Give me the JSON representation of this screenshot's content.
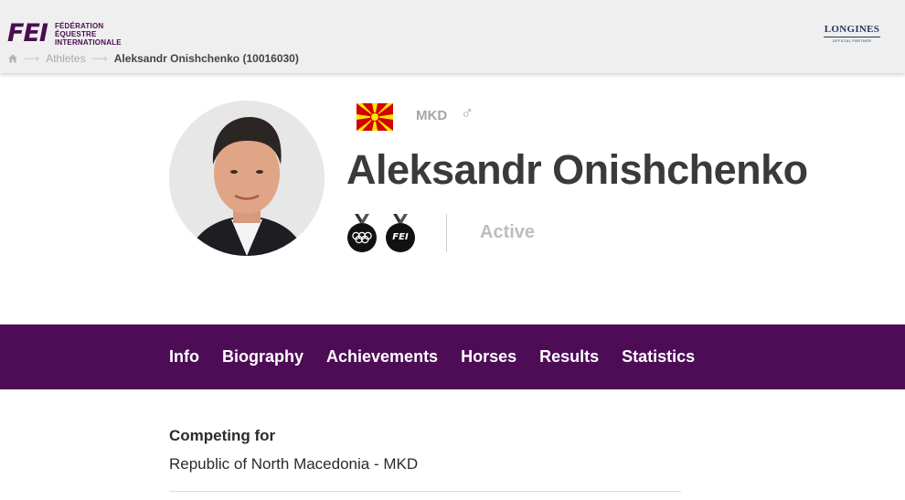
{
  "header": {
    "logo_mark": "FEI",
    "logo_text_lines": [
      "FÉDÉRATION",
      "ÉQUESTRE",
      "INTERNATIONALE"
    ],
    "sponsor_name": "LONGINES",
    "sponsor_sub": "OFFICIAL PARTNER"
  },
  "breadcrumb": {
    "home_icon": "home-icon",
    "items": [
      "Athletes",
      "Aleksandr Onishchenko (10016030)"
    ]
  },
  "profile": {
    "name": "Aleksandr Onishchenko",
    "country_code": "MKD",
    "gender_symbol": "♂",
    "status": "Active",
    "badges": [
      "olympic-medal-icon",
      "fei-medal-icon"
    ],
    "badge_fei_text": "FEI"
  },
  "nav": {
    "tabs": [
      "Info",
      "Biography",
      "Achievements",
      "Horses",
      "Results",
      "Statistics"
    ]
  },
  "info": {
    "competing_label": "Competing for",
    "competing_value": "Republic of North Macedonia - MKD"
  },
  "colors": {
    "brand_purple": "#4e0c57",
    "flag_red": "#d20000",
    "flag_yellow": "#ffe600"
  }
}
